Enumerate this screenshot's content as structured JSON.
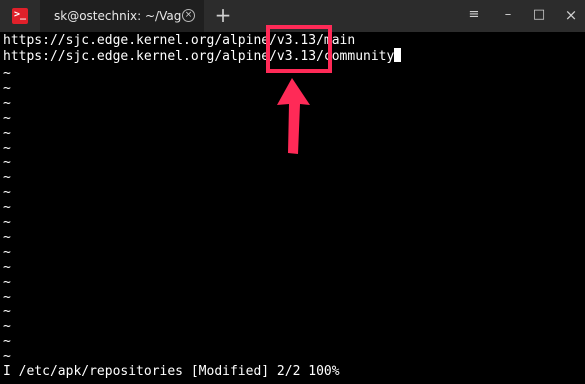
{
  "window": {
    "tab_title": "sk@ostechnix: ~/Vagra",
    "tab_close_glyph": "×",
    "new_tab_glyph": "+",
    "controls": {
      "menu_glyph": "≡",
      "minimize_glyph": "–",
      "maximize_glyph": "□",
      "close_glyph": "×"
    }
  },
  "terminal": {
    "lines": [
      "https://sjc.edge.kernel.org/alpine/v3.13/main",
      "https://sjc.edge.kernel.org/alpine/v3.13/community"
    ],
    "empty_line_marker": "~",
    "status_line": "I /etc/apk/repositories [Modified] 2/2 100%"
  },
  "colors": {
    "highlight": "#ff2a57",
    "app_icon": "#e0202a"
  },
  "icons": {
    "app": "terminal-icon",
    "menu": "hamburger-icon",
    "close_tab": "close-icon",
    "annotation": "arrow-up-icon"
  }
}
